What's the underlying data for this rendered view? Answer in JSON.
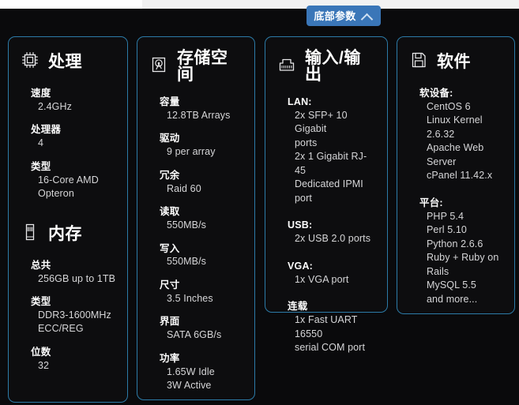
{
  "toggle": {
    "label": "底部参数",
    "icon": "chevron-up-icon",
    "accent_color": "#3a76b8"
  },
  "theme": {
    "page_background": "#0a0a0c",
    "card_background": "#0d0d0f",
    "card_border": "#2c7ba8",
    "label_color": "#fdfdfd",
    "value_color": "#d6d6d8"
  },
  "cards": [
    {
      "sections": [
        {
          "icon": "cpu-chip-icon",
          "title": "处理",
          "specs": [
            {
              "label": "速度",
              "values": [
                "2.4GHz"
              ]
            },
            {
              "label": "处理器",
              "values": [
                "4"
              ]
            },
            {
              "label": "类型",
              "values": [
                "16-Core AMD",
                "Opteron"
              ]
            }
          ]
        },
        {
          "icon": "memory-stick-icon",
          "title": "内存",
          "specs": [
            {
              "label": "总共",
              "values": [
                "256GB up to 1TB"
              ]
            },
            {
              "label": "类型",
              "values": [
                "DDR3-1600MHz",
                "ECC/REG"
              ]
            },
            {
              "label": "位数",
              "values": [
                "32"
              ]
            }
          ]
        }
      ]
    },
    {
      "sections": [
        {
          "icon": "hard-disk-icon",
          "title": "存储空间",
          "specs": [
            {
              "label": "容量",
              "values": [
                "12.8TB Arrays"
              ]
            },
            {
              "label": "驱动",
              "values": [
                "9 per array"
              ]
            },
            {
              "label": "冗余",
              "values": [
                "Raid 60"
              ]
            },
            {
              "label": "读取",
              "values": [
                "550MB/s"
              ]
            },
            {
              "label": "写入",
              "values": [
                "550MB/s"
              ]
            },
            {
              "label": "尺寸",
              "values": [
                "3.5 Inches"
              ]
            },
            {
              "label": "界面",
              "values": [
                "SATA 6GB/s"
              ]
            },
            {
              "label": "功率",
              "values": [
                "1.65W Idle",
                "3W Active"
              ]
            }
          ]
        }
      ]
    },
    {
      "sections": [
        {
          "icon": "ethernet-port-icon",
          "title": "输入/输出",
          "specs": [
            {
              "label": "LAN:",
              "values": [
                "2x SFP+ 10 Gigabit",
                "ports",
                "2x 1 Gigabit RJ-45",
                "Dedicated IPMI port"
              ]
            },
            {
              "label": "USB:",
              "values": [
                "2x USB 2.0 ports"
              ]
            },
            {
              "label": "VGA:",
              "values": [
                "1x VGA port"
              ]
            },
            {
              "label": "连载",
              "values": [
                "1x Fast UART 16550",
                "serial COM port"
              ]
            }
          ]
        }
      ]
    },
    {
      "sections": [
        {
          "icon": "floppy-disk-icon",
          "title": "软件",
          "specs": [
            {
              "label": "软设备:",
              "values": [
                "CentOS 6",
                "Linux Kernel 2.6.32",
                "Apache Web Server",
                "cPanel 11.42.x"
              ]
            },
            {
              "label": "平台:",
              "values": [
                "PHP 5.4",
                "Perl 5.10",
                "Python 2.6.6",
                "Ruby + Ruby on Rails",
                "MySQL 5.5",
                "and more..."
              ]
            }
          ]
        }
      ]
    }
  ]
}
